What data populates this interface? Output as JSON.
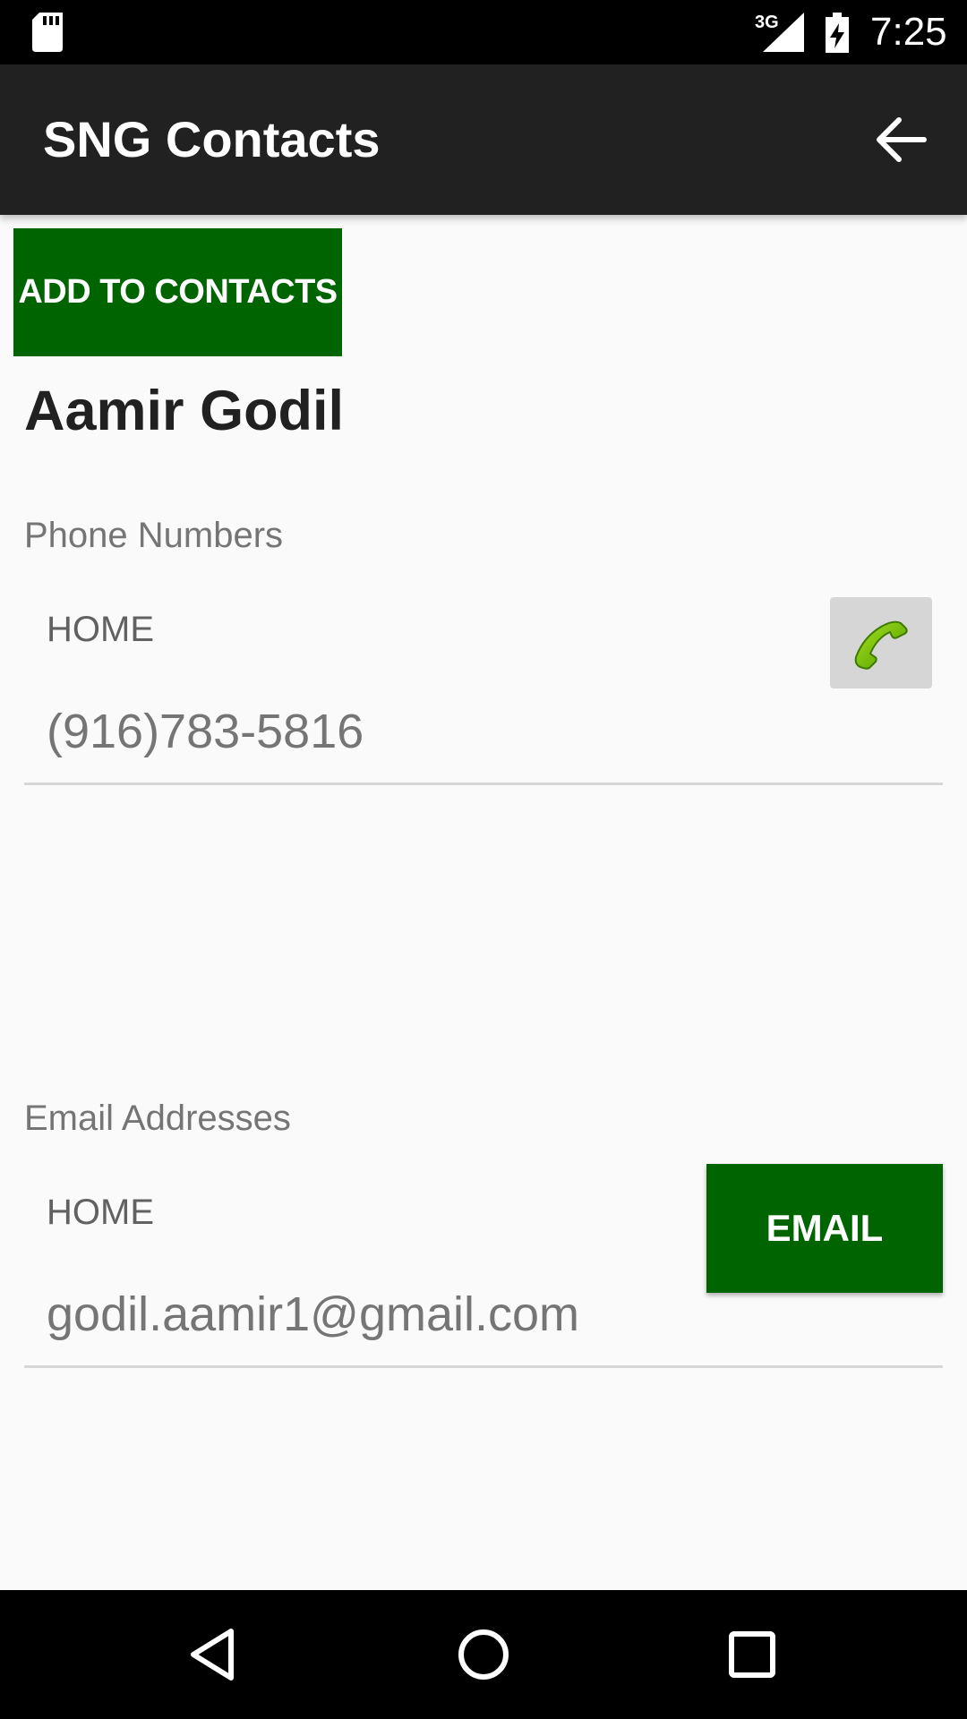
{
  "status_bar": {
    "network": "3G",
    "time": "7:25"
  },
  "app_bar": {
    "title": "SNG Contacts",
    "back_icon": "arrow-back-icon"
  },
  "actions": {
    "add_to_contacts_label": "ADD TO CONTACTS"
  },
  "contact": {
    "name": "Aamir Godil",
    "phone_section": {
      "heading": "Phone Numbers",
      "entries": [
        {
          "type": "HOME",
          "value": "(916)783-5816",
          "action_icon": "phone-icon"
        }
      ]
    },
    "email_section": {
      "heading": "Email Addresses",
      "entries": [
        {
          "type": "HOME",
          "value": "godil.aamir1@gmail.com",
          "action_label": "EMAIL"
        }
      ]
    }
  },
  "colors": {
    "app_bar": "#212121",
    "accent_green": "#006400",
    "background": "#fafafa"
  }
}
